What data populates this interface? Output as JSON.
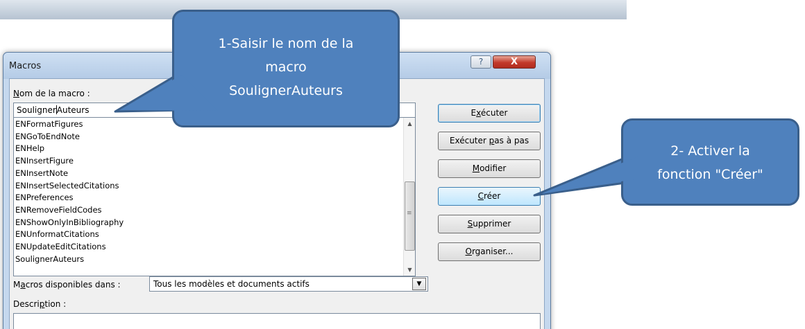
{
  "dialog": {
    "title": "Macros",
    "help_glyph": "?",
    "close_glyph": "X",
    "macro_name_label": "Nom de la macro :",
    "macro_name_value_before_caret": "Souligner",
    "macro_name_value_after_caret": "Auteurs",
    "macro_list": [
      "ENFormatFigures",
      "ENGoToEndNote",
      "ENHelp",
      "ENInsertFigure",
      "ENInsertNote",
      "ENInsertSelectedCitations",
      "ENPreferences",
      "ENRemoveFieldCodes",
      "ENShowOnlyInBibliography",
      "ENUnformatCitations",
      "ENUpdateEditCitations",
      "SoulignerAuteurs"
    ],
    "buttons": {
      "run": "Exécuter",
      "step": "Exécuter pas à pas",
      "edit": "Modifier",
      "create": "Créer",
      "delete": "Supprimer",
      "organizer": "Organiser..."
    },
    "available_in_label": "Macros disponibles dans :",
    "available_in_value": "Tous les modèles et documents actifs",
    "description_label": "Description :",
    "description_value": ""
  },
  "callouts": {
    "step1": [
      "1-Saisir le nom de la",
      "macro",
      "SoulignerAuteurs"
    ],
    "step2": [
      "2- Activer la",
      "fonction \"Créer\""
    ]
  },
  "colors": {
    "callout_fill": "#4f81bd",
    "callout_border": "#3a5f8b",
    "close_button": "#c23a2b",
    "window_frame": "#c5d8ee"
  }
}
